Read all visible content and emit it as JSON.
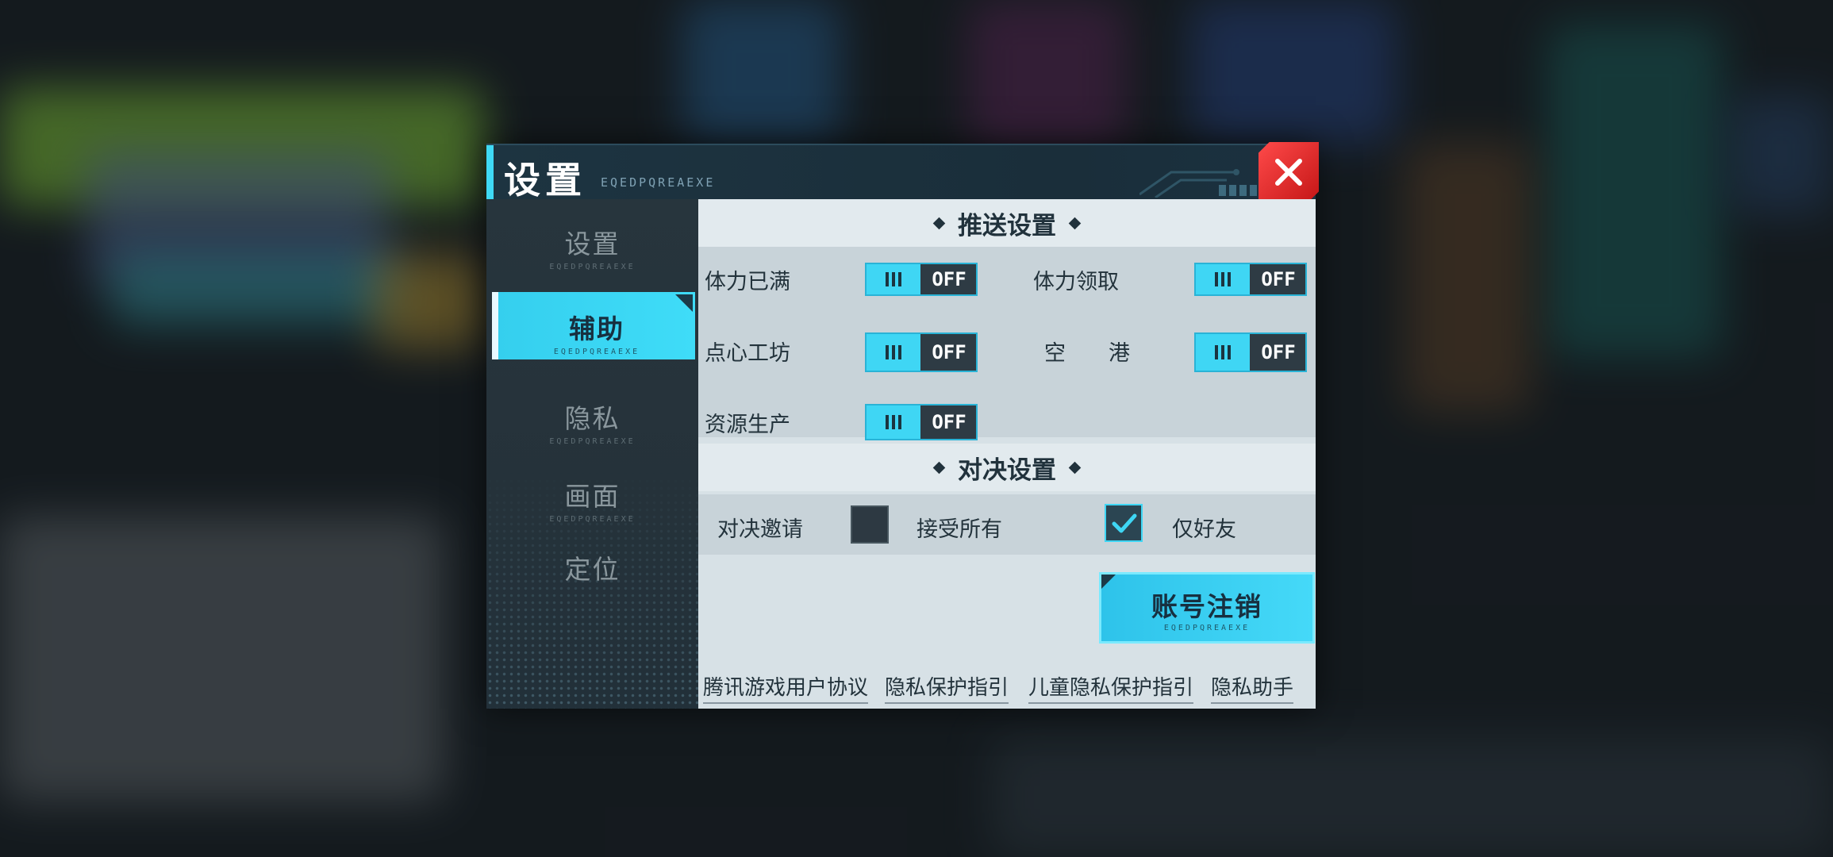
{
  "dialog": {
    "title": "设置",
    "subtitle": "EQEDPQREAEXE"
  },
  "sidebar": {
    "items": [
      {
        "label": "设置",
        "sub": "EQEDPQREAEXE"
      },
      {
        "label": "辅助",
        "sub": "EQEDPQREAEXE"
      },
      {
        "label": "隐私",
        "sub": "EQEDPQREAEXE"
      },
      {
        "label": "画面",
        "sub": "EQEDPQREAEXE"
      },
      {
        "label": "定位"
      }
    ],
    "active_index": 1
  },
  "push": {
    "title": "推送设置",
    "items": [
      {
        "label": "体力已满",
        "state": "OFF"
      },
      {
        "label": "体力领取",
        "state": "OFF"
      },
      {
        "label": "点心工坊",
        "state": "OFF"
      },
      {
        "label": "空　　港",
        "state": "OFF"
      },
      {
        "label": "资源生产",
        "state": "OFF"
      }
    ]
  },
  "duel": {
    "title": "对决设置",
    "invite_label": "对决邀请",
    "options": [
      {
        "label": "接受所有",
        "checked": false
      },
      {
        "label": "仅好友",
        "checked": true
      }
    ]
  },
  "cancel_account": {
    "label": "账号注销",
    "sub": "EQEDPQREAEXE"
  },
  "links": [
    "腾讯游戏用户协议",
    "隐私保护指引",
    "儿童隐私保护指引",
    "隐私助手"
  ],
  "colors": {
    "accent": "#3fd6f4",
    "close": "#e02424",
    "panel": "#d7e1e6",
    "sidebar": "#27353d"
  }
}
